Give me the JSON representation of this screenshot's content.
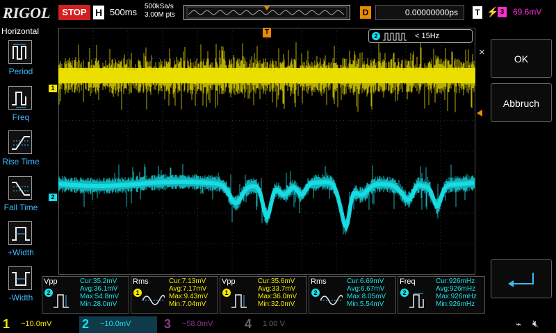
{
  "topbar": {
    "logo": "RIGOL",
    "run_state": "STOP",
    "horizontal_label": "H",
    "timebase": "500ms",
    "sample_rate": "500kSa/s",
    "mem_depth": "3.00M pts",
    "delay_label": "D",
    "delay_value": "0.00000000ps",
    "trigger_label": "T",
    "trigger_edge": "⚡",
    "trigger_source": "3",
    "trigger_level": "69.6mV"
  },
  "left_menu": {
    "title": "Horizontal",
    "items": [
      {
        "label": "Period",
        "icon": "period-icon"
      },
      {
        "label": "Freq",
        "icon": "freq-icon"
      },
      {
        "label": "Rise Time",
        "icon": "rise-time-icon"
      },
      {
        "label": "Fall Time",
        "icon": "fall-time-icon"
      },
      {
        "label": "+Width",
        "icon": "pos-width-icon"
      },
      {
        "label": "-Width",
        "icon": "neg-width-icon"
      }
    ]
  },
  "screen": {
    "freq_counter_channel": "2",
    "freq_counter_value": "< 15Hz",
    "trigger_pos_marker": "T",
    "ch1_marker": "1",
    "ch2_marker": "2"
  },
  "right_menu": {
    "ok": "OK",
    "cancel": "Abbruch",
    "close": "✕"
  },
  "measurements": [
    {
      "name": "Vpp",
      "channel": "2",
      "color": "#18e0e8",
      "cur": "Cur:35.2mV",
      "avg": "Avg:36.1mV",
      "max": "Max:54.8mV",
      "min": "Min:28.0mV"
    },
    {
      "name": "Rms",
      "channel": "1",
      "color": "#f4e800",
      "cur": "Cur:7.13mV",
      "avg": "Avg:7.17mV",
      "max": "Max:9.43mV",
      "min": "Min:7.04mV"
    },
    {
      "name": "Vpp",
      "channel": "1",
      "color": "#f4e800",
      "cur": "Cur:35.6mV",
      "avg": "Avg:33.7mV",
      "max": "Max:36.0mV",
      "min": "Min:32.0mV"
    },
    {
      "name": "Rms",
      "channel": "2",
      "color": "#18e0e8",
      "cur": "Cur:6.69mV",
      "avg": "Avg:6.67mV",
      "max": "Max:8.05mV",
      "min": "Min:5.54mV"
    },
    {
      "name": "Freq",
      "channel": "2",
      "color": "#18e0e8",
      "cur": "Cur:926mHz",
      "avg": "Avg:926mHz",
      "max": "Max:926mHz",
      "min": "Min:926mHz"
    }
  ],
  "channels": [
    {
      "num": "1",
      "scale": "~10.0mV",
      "color": "#f4e800",
      "active": true
    },
    {
      "num": "2",
      "scale": "~10.0mV",
      "color": "#18e0e8",
      "active": true
    },
    {
      "num": "3",
      "scale": "~58.0mV",
      "color": "#8a3a8a",
      "active": false
    },
    {
      "num": "4",
      "scale": "1.00 V",
      "color": "#666666",
      "active": false
    }
  ],
  "colors": {
    "ch1": "#f4e800",
    "ch2": "#18e0e8",
    "trigger": "#ff2bd0",
    "accent": "#3cb9ff",
    "stop": "#d21f1f",
    "delay": "#e88a00"
  }
}
